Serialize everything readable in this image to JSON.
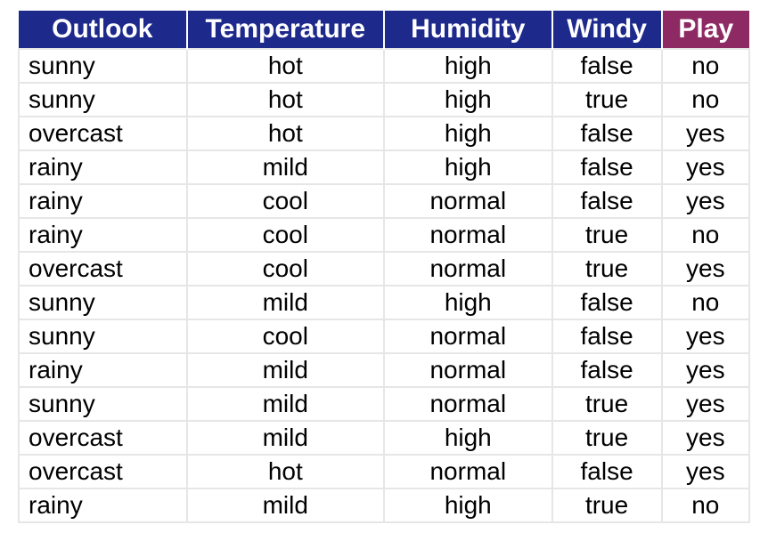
{
  "colors": {
    "header_feature_bg": "#1d2a8c",
    "header_target_bg": "#8e2a63",
    "header_fg": "#ffffff",
    "cell_border": "#e6e6e6"
  },
  "table": {
    "columns": [
      {
        "key": "outlook",
        "label": "Outlook",
        "role": "feature"
      },
      {
        "key": "temperature",
        "label": "Temperature",
        "role": "feature"
      },
      {
        "key": "humidity",
        "label": "Humidity",
        "role": "feature"
      },
      {
        "key": "windy",
        "label": "Windy",
        "role": "feature"
      },
      {
        "key": "play",
        "label": "Play",
        "role": "target"
      }
    ],
    "rows": [
      {
        "outlook": "sunny",
        "temperature": "hot",
        "humidity": "high",
        "windy": "false",
        "play": "no"
      },
      {
        "outlook": "sunny",
        "temperature": "hot",
        "humidity": "high",
        "windy": "true",
        "play": "no"
      },
      {
        "outlook": "overcast",
        "temperature": "hot",
        "humidity": "high",
        "windy": "false",
        "play": "yes"
      },
      {
        "outlook": "rainy",
        "temperature": "mild",
        "humidity": "high",
        "windy": "false",
        "play": "yes"
      },
      {
        "outlook": "rainy",
        "temperature": "cool",
        "humidity": "normal",
        "windy": "false",
        "play": "yes"
      },
      {
        "outlook": "rainy",
        "temperature": "cool",
        "humidity": "normal",
        "windy": "true",
        "play": "no"
      },
      {
        "outlook": "overcast",
        "temperature": "cool",
        "humidity": "normal",
        "windy": "true",
        "play": "yes"
      },
      {
        "outlook": "sunny",
        "temperature": "mild",
        "humidity": "high",
        "windy": "false",
        "play": "no"
      },
      {
        "outlook": "sunny",
        "temperature": "cool",
        "humidity": "normal",
        "windy": "false",
        "play": "yes"
      },
      {
        "outlook": "rainy",
        "temperature": "mild",
        "humidity": "normal",
        "windy": "false",
        "play": "yes"
      },
      {
        "outlook": "sunny",
        "temperature": "mild",
        "humidity": "normal",
        "windy": "true",
        "play": "yes"
      },
      {
        "outlook": "overcast",
        "temperature": "mild",
        "humidity": "high",
        "windy": "true",
        "play": "yes"
      },
      {
        "outlook": "overcast",
        "temperature": "hot",
        "humidity": "normal",
        "windy": "false",
        "play": "yes"
      },
      {
        "outlook": "rainy",
        "temperature": "mild",
        "humidity": "high",
        "windy": "true",
        "play": "no"
      }
    ]
  }
}
